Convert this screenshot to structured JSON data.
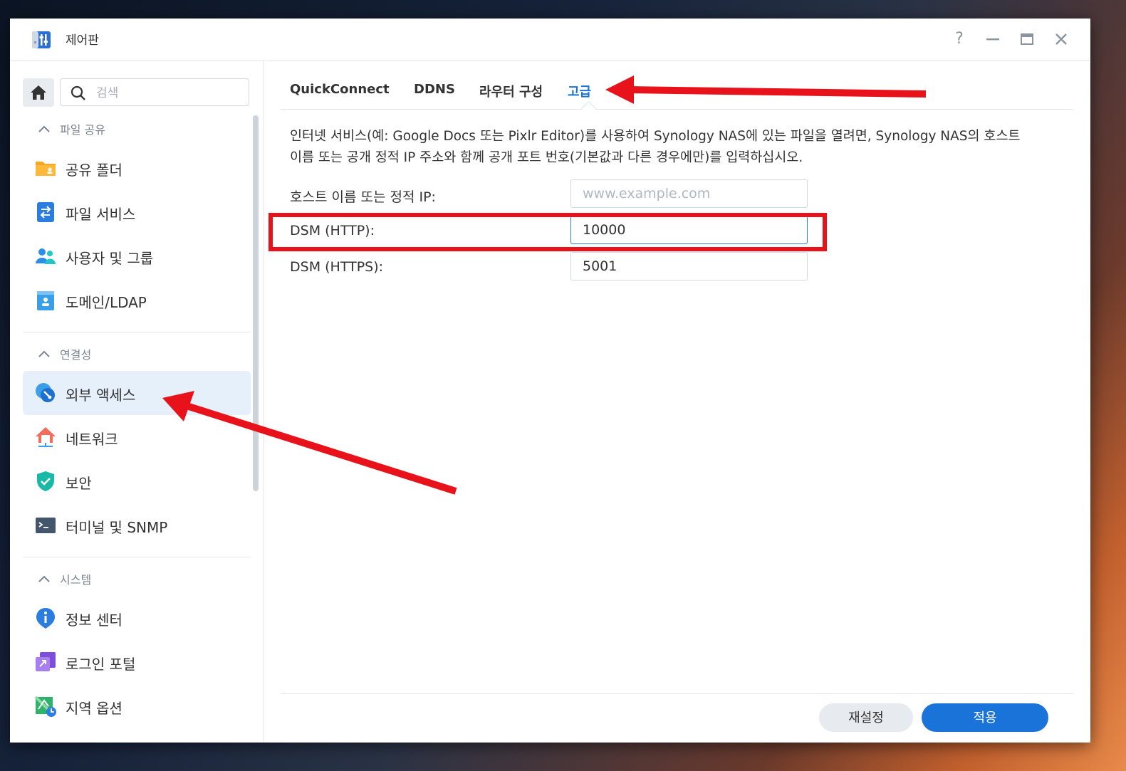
{
  "window": {
    "title": "제어판"
  },
  "controls": {
    "help": "?"
  },
  "search": {
    "placeholder": "검색"
  },
  "sidebar": {
    "groups": [
      {
        "label": "파일 공유"
      },
      {
        "label": "연결성"
      },
      {
        "label": "시스템"
      }
    ],
    "items": [
      {
        "label": "공유 폴더",
        "icon": "shared-folder-icon"
      },
      {
        "label": "파일 서비스",
        "icon": "file-services-icon"
      },
      {
        "label": "사용자 및 그룹",
        "icon": "users-groups-icon"
      },
      {
        "label": "도메인/LDAP",
        "icon": "domain-ldap-icon"
      },
      {
        "label": "외부 액세스",
        "icon": "external-access-icon",
        "active": true
      },
      {
        "label": "네트워크",
        "icon": "network-icon"
      },
      {
        "label": "보안",
        "icon": "security-shield-icon"
      },
      {
        "label": "터미널 및 SNMP",
        "icon": "terminal-icon"
      },
      {
        "label": "정보 센터",
        "icon": "info-center-icon"
      },
      {
        "label": "로그인 포털",
        "icon": "login-portal-icon"
      },
      {
        "label": "지역 옵션",
        "icon": "regional-options-icon"
      }
    ]
  },
  "tabs": [
    {
      "label": "QuickConnect"
    },
    {
      "label": "DDNS"
    },
    {
      "label": "라우터 구성"
    },
    {
      "label": "고급",
      "active": true
    }
  ],
  "main": {
    "description_line1": "인터넷 서비스(예: Google Docs 또는 Pixlr Editor)를 사용하여 Synology NAS에 있는 파일을 열려면, Synology NAS의 호스트",
    "description_line2": "이름 또는 공개 정적 IP 주소와 함께 공개 포트 번호(기본값과 다른 경우에만)를 입력하십시오.",
    "fields": [
      {
        "label": "호스트 이름 또는 정적 IP:",
        "value": "",
        "placeholder": "www.example.com"
      },
      {
        "label": "DSM (HTTP):",
        "value": "10000",
        "placeholder": ""
      },
      {
        "label": "DSM (HTTPS):",
        "value": "5001",
        "placeholder": ""
      }
    ]
  },
  "footer": {
    "reset_label": "재설정",
    "apply_label": "적용"
  },
  "colors": {
    "accent": "#1a73d9",
    "annotation": "#e8121a",
    "active_item_bg": "#e6f0fb"
  }
}
